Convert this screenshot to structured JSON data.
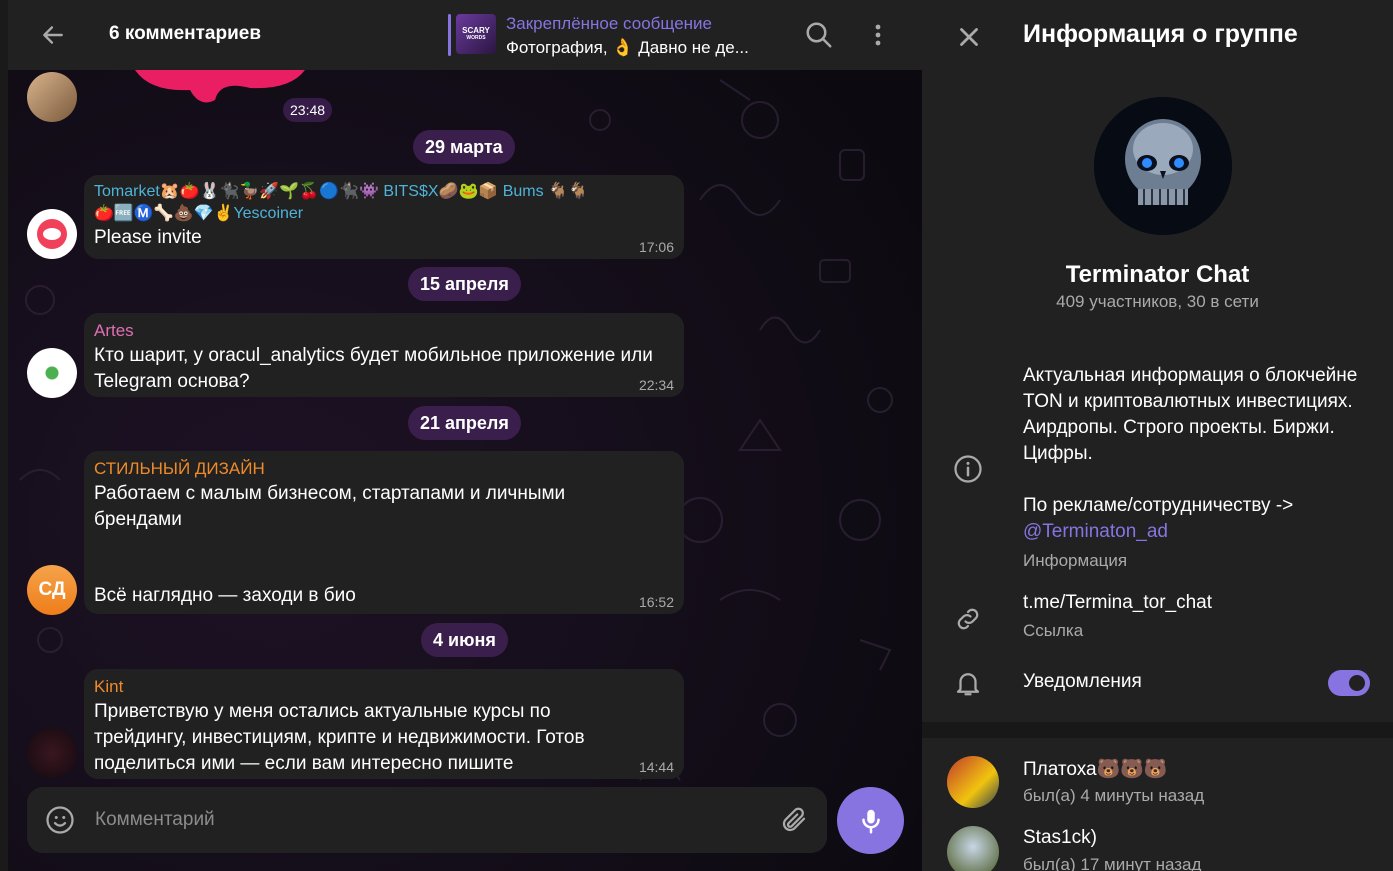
{
  "header": {
    "title": "6 комментариев",
    "pinned_title": "Закреплённое сообщение",
    "pinned_text": "Фотография, 👌 Давно не де...",
    "pinned_thumb_line1": "SCARY",
    "pinned_thumb_line2": "WORDS"
  },
  "top_message": {
    "time": "23:48"
  },
  "messages": [
    {
      "date": "29 марта",
      "sender": "Tomarket🐹🍅🐰🐈‍⬛🦆🚀🌱🍒🔵🐈‍⬛👾 BITS$X🥔🐸📦 Bums 🐐🐐",
      "sender2": "🍅🆓Ⓜ️🦴💩💎✌️Yescoiner",
      "text": "Please invite",
      "time": "17:06",
      "name_color": "#4fb3d9"
    },
    {
      "date": "15 апреля",
      "sender": "Artes",
      "text": "Кто шарит, у oracul_analytics будет мобильное приложение или Telegram основа?",
      "time": "22:34",
      "name_color": "#e06fb6"
    },
    {
      "date": "21 апреля",
      "sender": "СТИЛЬНЫЙ ДИЗАЙН",
      "text": "Работаем с малым бизнесом, стартапами и личными брендами",
      "text2": "Всё наглядно — заходи в био",
      "time": "16:52",
      "avatar_initials": "СД",
      "name_color": "#ef8a2a"
    },
    {
      "date": "4 июня",
      "sender": "Kint",
      "text": "Приветствую у меня остались актуальные курсы по трейдингу, инвестициям, крипте и недвижимости. Готов поделиться ими — если вам интересно пишите",
      "time": "14:44",
      "name_color": "#ef8a2a"
    }
  ],
  "composer": {
    "placeholder": "Комментарий"
  },
  "info_panel": {
    "title": "Информация о группе",
    "group_name": "Terminator Chat",
    "group_sub": "409 участников, 30 в сети",
    "description": "Актуальная информация о блокчейне TON и криптовалютных инвестициях. Аирдропы. Строго проекты. Биржи. Цифры.",
    "ad_line": "По рекламе/сотрудничеству ->",
    "ad_link": "@Terminaton_ad",
    "description_label": "Информация",
    "link": "t.me/Termina_tor_chat",
    "link_label": "Ссылка",
    "notifications_label": "Уведомления",
    "notifications_on": true,
    "members": [
      {
        "name": "Платоха🐻🐻🐻",
        "status": "был(а) 4 минуты назад"
      },
      {
        "name": "Stas1ck)",
        "status": "был(а) 17 минут назад"
      }
    ]
  },
  "colors": {
    "accent": "#8774e1",
    "panel": "#212121",
    "bubble": "#212121",
    "date_chip": "#3a1f4d"
  }
}
